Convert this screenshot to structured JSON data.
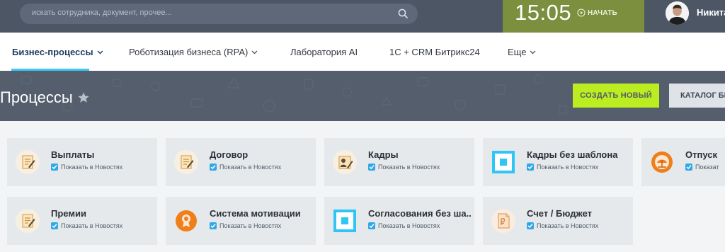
{
  "search": {
    "placeholder": "искать сотрудника, документ, прочее..."
  },
  "clock": {
    "time": "15:05",
    "start_label": "НАЧАТЬ"
  },
  "user": {
    "name": "Никита"
  },
  "nav": {
    "items": [
      {
        "label": "Бизнес-процессы",
        "dropdown": true
      },
      {
        "label": "Роботизация бизнеса (RPA)",
        "dropdown": true
      },
      {
        "label": "Лаборатория AI",
        "dropdown": false
      },
      {
        "label": "1С + CRM Битрикс24",
        "dropdown": false
      },
      {
        "label": "Еще",
        "dropdown": true
      }
    ]
  },
  "header": {
    "title": "Процессы",
    "create_button": "СОЗДАТЬ НОВЫЙ",
    "catalog_button": "КАТАЛОГ БИ"
  },
  "cards": [
    {
      "title": "Выплаты",
      "icon": "document-pen-icon",
      "show_in_news": "Показать в Новостях"
    },
    {
      "title": "Договор",
      "icon": "document-pen-icon",
      "show_in_news": "Показать в Новостях"
    },
    {
      "title": "Кадры",
      "icon": "personnel-document-icon",
      "show_in_news": "Показать в Новостях"
    },
    {
      "title": "Кадры без шаблона",
      "icon": "square-frame-icon",
      "show_in_news": "Показать в Новостях"
    },
    {
      "title": "Отпуск",
      "icon": "vacation-icon",
      "show_in_news": "Показат"
    },
    {
      "title": "Премии",
      "icon": "document-pen-icon",
      "show_in_news": "Показать в Новостях"
    },
    {
      "title": "Система мотивации",
      "icon": "medal-icon",
      "show_in_news": "Показать в Новостях"
    },
    {
      "title": "Согласования без ша...",
      "icon": "square-frame-icon",
      "show_in_news": "Показать в Новостях"
    },
    {
      "title": "Счет / Бюджет",
      "icon": "invoice-icon",
      "show_in_news": "Показать в Новостях"
    }
  ],
  "colors": {
    "topbar": "#4c5665",
    "clock_bg": "#7b8f3e",
    "accent_green": "#bbed21",
    "nav_underline": "#3bc8f5",
    "checkbox": "#2fa7e8"
  }
}
